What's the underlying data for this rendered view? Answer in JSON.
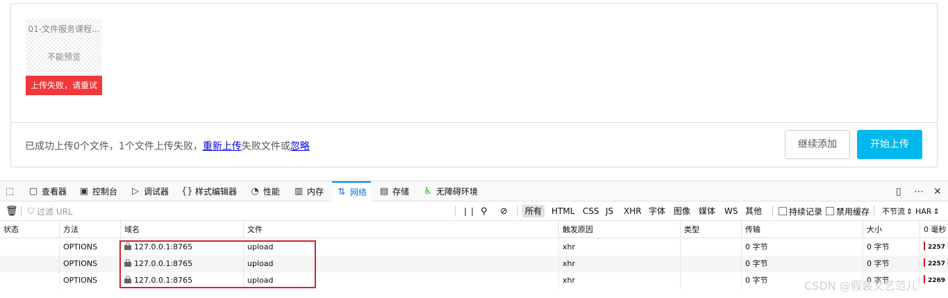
{
  "upload": {
    "file_name": "01-文件服务课程...",
    "preview_text": "不能预览",
    "error_text": "上传失败，请重试",
    "status_prefix": "已成功上传0个文件，1个文件上传失败，",
    "retry_link": "重新上传",
    "status_middle": "失败文件或",
    "ignore_link": "忽略",
    "continue_button": "继续添加",
    "start_button": "开始上传",
    "accent_color": "#00b7ee",
    "error_color": "#f0373a"
  },
  "devtools": {
    "tabs": [
      {
        "icon": "element-picker-icon",
        "label": ""
      },
      {
        "icon": "inspector-icon",
        "label": "查看器"
      },
      {
        "icon": "console-icon",
        "label": "控制台"
      },
      {
        "icon": "debugger-icon",
        "label": "调试器"
      },
      {
        "icon": "style-editor-icon",
        "label": "样式编辑器"
      },
      {
        "icon": "performance-icon",
        "label": "性能"
      },
      {
        "icon": "memory-icon",
        "label": "内存"
      },
      {
        "icon": "network-icon",
        "label": "网络"
      },
      {
        "icon": "storage-icon",
        "label": "存储"
      },
      {
        "icon": "accessibility-icon",
        "label": "无障碍环境"
      }
    ],
    "active_tab": "网络",
    "filter_placeholder": "过滤 URL",
    "type_filters": [
      "所有",
      "HTML",
      "CSS",
      "JS",
      "XHR",
      "字体",
      "图像",
      "媒体",
      "WS",
      "其他"
    ],
    "persist_logs": "持续记录",
    "disable_cache": "禁用缓存",
    "throttle": "不节流",
    "har": "HAR",
    "columns": [
      "状态",
      "方法",
      "域名",
      "文件",
      "触发原因",
      "类型",
      "传输",
      "大小",
      "0 毫秒"
    ],
    "rows": [
      {
        "status": "",
        "method": "OPTIONS",
        "domain": "127.0.0.1:8765",
        "file": "upload",
        "cause": "xhr",
        "type": "",
        "transferred": "0 字节",
        "size": "0 字节",
        "timing": "2257 毫"
      },
      {
        "status": "",
        "method": "OPTIONS",
        "domain": "127.0.0.1:8765",
        "file": "upload",
        "cause": "xhr",
        "type": "",
        "transferred": "0 字节",
        "size": "0 字节",
        "timing": "2257 毫"
      },
      {
        "status": "",
        "method": "OPTIONS",
        "domain": "127.0.0.1:8765",
        "file": "upload",
        "cause": "xhr",
        "type": "",
        "transferred": "0 字节",
        "size": "0 字节",
        "timing": "2269"
      }
    ]
  },
  "watermark": "CSDN @假装文艺范儿"
}
